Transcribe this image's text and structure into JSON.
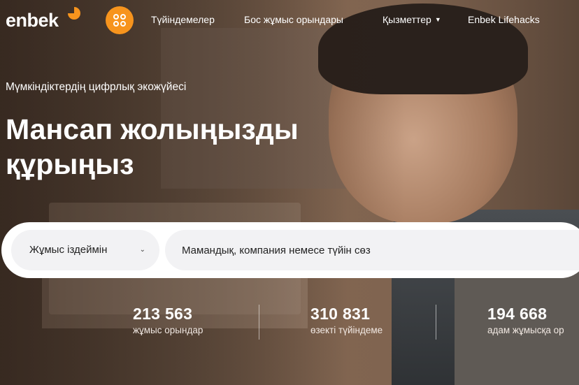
{
  "brand": {
    "logo_text": "enbek",
    "accent_color": "#f7941d"
  },
  "nav": {
    "apps_icon": "apps-grid-icon",
    "links": [
      {
        "label": "Түйіндемелер"
      },
      {
        "label": "Бос жұмыс орындары"
      },
      {
        "label": "Қызметтер",
        "has_dropdown": true
      },
      {
        "label": "Enbek Lifehacks"
      }
    ]
  },
  "hero": {
    "eyebrow": "Мүмкіндіктердің цифрлық экожүйесі",
    "title_line1": "Мансап жолыңызды",
    "title_line2": "құрыңыз"
  },
  "search": {
    "mode_selected": "Жұмыс іздеймін",
    "placeholder": "Мамандық, компания немесе түйін сөз"
  },
  "stats": [
    {
      "value": "213 563",
      "label": "жұмыс орындар"
    },
    {
      "value": "310 831",
      "label": "өзекті түйіндеме"
    },
    {
      "value": "194 668",
      "label": "адам жұмысқа ор"
    }
  ]
}
